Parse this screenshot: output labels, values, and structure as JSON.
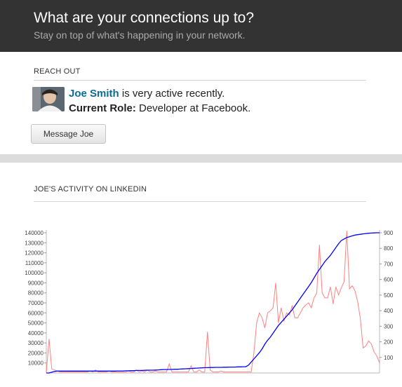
{
  "header": {
    "title": "What are your connections up to?",
    "subtitle": "Stay on top of what's happening in your network."
  },
  "reach_out": {
    "label": "REACH OUT",
    "name": "Joe Smith",
    "activity_text": " is very active recently.",
    "role_label": "Current Role:",
    "role_value": " Developer at Facebook.",
    "message_button": "Message Joe"
  },
  "activity": {
    "label": "JOE'S ACTIVITY ON LINKEDIN"
  },
  "colors": {
    "header_bg": "#333333",
    "link": "#0b6b95",
    "series_left": "#ff8080",
    "series_right": "#0000ff"
  },
  "chart_data": {
    "type": "line",
    "left_axis": {
      "ylim": [
        0,
        140000
      ],
      "ticks": [
        10000,
        20000,
        30000,
        40000,
        50000,
        60000,
        70000,
        80000,
        90000,
        100000,
        110000,
        120000,
        130000,
        140000
      ]
    },
    "right_axis": {
      "ylim": [
        0,
        900
      ],
      "ticks": [
        100,
        200,
        300,
        400,
        500,
        600,
        700,
        800,
        900
      ]
    },
    "series": [
      {
        "axis": "left",
        "color": "#ff8080",
        "values": [
          0,
          34000,
          4000,
          3000,
          2000,
          1000,
          1000,
          1000,
          1000,
          1000,
          1000,
          1000,
          1000,
          1000,
          1000,
          1000,
          2000,
          1000,
          3000,
          1000,
          1000,
          1000,
          1000,
          2000,
          1000,
          1000,
          1000,
          1000,
          1000,
          1000,
          2000,
          1000,
          1000,
          3000,
          1000,
          2000,
          1000,
          3000,
          1000,
          1000,
          2000,
          1000,
          1000,
          1000,
          1000,
          9000,
          1000,
          1000,
          1000,
          1000,
          1000,
          1000,
          1000,
          7000,
          1000,
          1000,
          3000,
          1000,
          1000,
          41000,
          3000,
          1000,
          1000,
          1000,
          2000,
          1000,
          1000,
          1000,
          1000,
          1000,
          1000,
          1000,
          1000,
          1000,
          1000,
          1000,
          20000,
          50000,
          60000,
          55000,
          45000,
          60000,
          62000,
          65000,
          90000,
          50000,
          65000,
          52000,
          60000,
          58000,
          67000,
          55000,
          55000,
          60000,
          65000,
          68000,
          70000,
          65000,
          75000,
          80000,
          128000,
          80000,
          75000,
          75000,
          86000,
          69000,
          86000,
          78000,
          85000,
          91000,
          142000,
          84000,
          87000,
          82000,
          71000,
          54000,
          25000,
          27000,
          32000,
          29000,
          21000,
          17000,
          10000
        ]
      },
      {
        "axis": "right",
        "color": "#0000ff",
        "values": [
          0,
          0,
          5,
          10,
          12,
          12,
          12,
          12,
          12,
          12,
          12,
          12,
          12,
          12,
          12,
          12,
          12,
          12,
          12,
          12,
          12,
          12,
          12,
          12,
          12,
          12,
          13,
          13,
          13,
          14,
          14,
          15,
          15,
          16,
          16,
          16,
          17,
          18,
          18,
          18,
          19,
          20,
          21,
          22,
          22,
          23,
          23,
          24,
          24,
          25,
          26,
          27,
          28,
          29,
          30,
          31,
          32,
          33,
          34,
          34,
          35,
          35,
          36,
          36,
          36,
          37,
          37,
          38,
          38,
          38,
          39,
          39,
          40,
          40,
          50,
          70,
          90,
          110,
          130,
          155,
          185,
          210,
          230,
          255,
          280,
          305,
          325,
          345,
          365,
          385,
          405,
          430,
          455,
          480,
          505,
          530,
          555,
          580,
          610,
          640,
          665,
          690,
          715,
          735,
          755,
          780,
          805,
          830,
          850,
          860,
          870,
          875,
          880,
          885,
          888,
          890,
          893,
          895,
          897,
          898,
          899,
          900,
          900
        ]
      }
    ]
  }
}
